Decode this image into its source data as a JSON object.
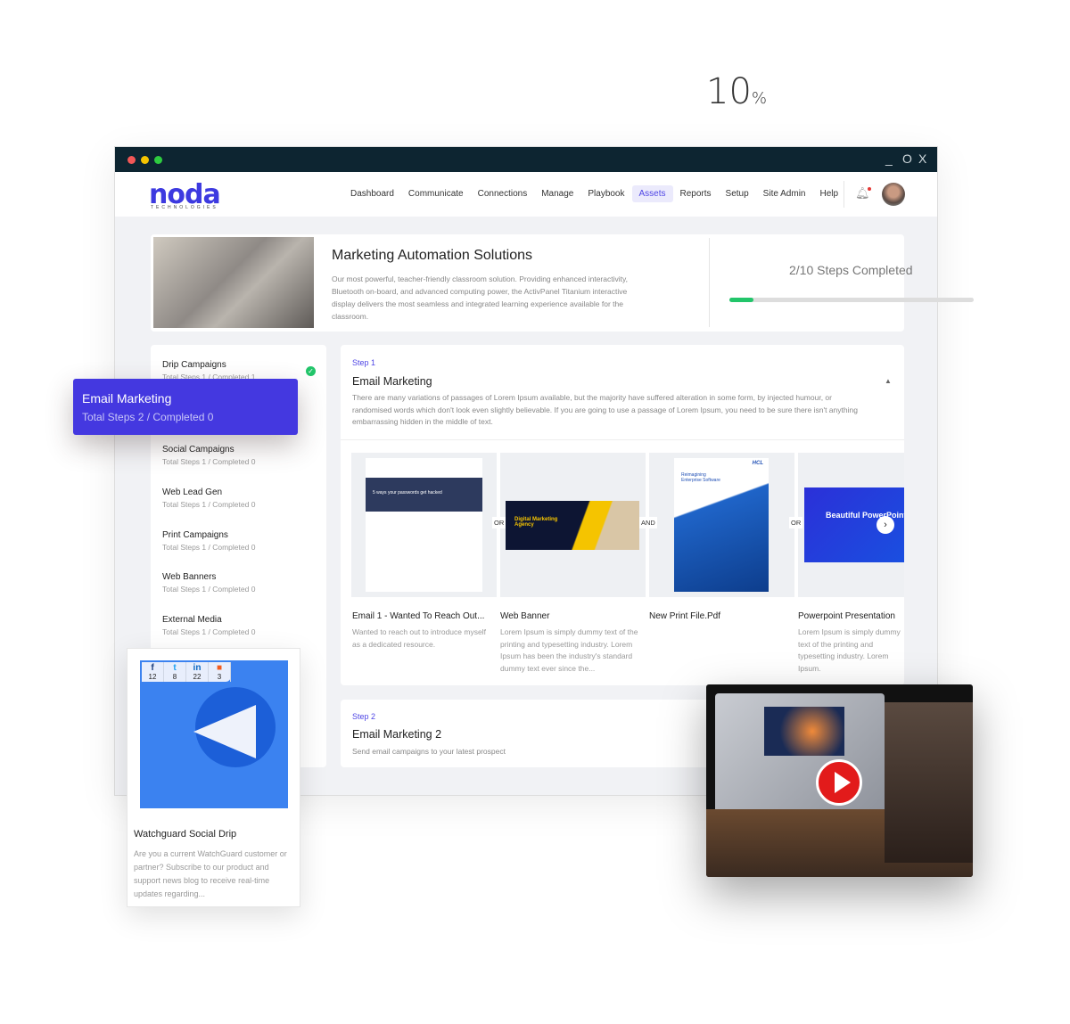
{
  "window": {
    "controls": [
      "_",
      "O",
      "X"
    ]
  },
  "header": {
    "logo": "noda",
    "logo_sub": "TECHNOLOGIES",
    "nav": [
      "Dashboard",
      "Communicate",
      "Connections",
      "Manage",
      "Playbook",
      "Assets",
      "Reports",
      "Setup",
      "Site Admin",
      "Help"
    ],
    "active": "Assets"
  },
  "hero": {
    "title": "Marketing Automation Solutions",
    "description": "Our most powerful, teacher-friendly classroom solution. Providing enhanced interactivity, Bluetooth on-board, and advanced computing power, the ActivPanel Titanium interactive display delivers the most seamless and integrated learning experience available for the classroom.",
    "percent": "10",
    "percent_sign": "%",
    "steps_completed": "2/10 Steps Completed",
    "progress": 10
  },
  "sidebar": {
    "items": [
      {
        "title": "Drip Campaigns",
        "sub": "Total Steps 1 / Completed 1"
      },
      {
        "title": "Email Marketing",
        "sub": "Total Steps 2 / Completed 0"
      },
      {
        "title": "Social Campaigns",
        "sub": "Total Steps 1 / Completed 0"
      },
      {
        "title": "Web Lead Gen",
        "sub": "Total Steps 1 / Completed 0"
      },
      {
        "title": "Print Campaigns",
        "sub": "Total Steps 1 / Completed 0"
      },
      {
        "title": "Web Banners",
        "sub": "Total Steps 1 / Completed 0"
      },
      {
        "title": "External Media",
        "sub": "Total Steps 1 / Completed 0"
      }
    ]
  },
  "step1": {
    "label": "Step 1",
    "title": "Email Marketing",
    "description": "There are many variations of passages of Lorem Ipsum available, but the majority have suffered alteration in some form, by injected humour, or randomised words which don't look even slightly believable. If you are going to use a passage of Lorem Ipsum, you need to be sure there isn't anything embarrassing hidden in the middle of text.",
    "assets": [
      {
        "name": "Email 1 - Wanted To Reach Out...",
        "description": "Wanted to reach out to introduce myself as a dedicated resource.",
        "thumb_text": "5 ways your passwords get hacked"
      },
      {
        "name": "Web Banner",
        "description": "Lorem Ipsum is simply dummy text of the printing and typesetting industry. Lorem Ipsum has been the industry's standard dummy text ever since the...",
        "thumb_text": "Digital Marketing Agency"
      },
      {
        "name": "New Print File.Pdf",
        "description": "",
        "thumb_text": "Reimagining Enterprise Software",
        "thumb_brand": "HCL"
      },
      {
        "name": "Powerpoint Presentation",
        "description": "Lorem Ipsum is simply dummy text of the printing and typesetting industry. Lorem Ipsum.",
        "thumb_text": "Beautiful PowerPoint Template"
      }
    ],
    "connectors": [
      "OR",
      "AND",
      "OR"
    ]
  },
  "step2": {
    "label": "Step 2",
    "title": "Email Marketing 2",
    "description": "Send email campaigns to your latest prospect"
  },
  "social": {
    "counts": [
      {
        "icon": "f",
        "n": "12"
      },
      {
        "icon": "t",
        "n": "8"
      },
      {
        "icon": "in",
        "n": "22"
      },
      {
        "icon": "b",
        "n": "3"
      }
    ],
    "title": "Watchguard Social Drip",
    "description": "Are you a current WatchGuard customer or partner? Subscribe to our product and support news blog to receive real-time updates regarding..."
  },
  "colors": {
    "accent": "#4438e0",
    "titlebar": "#0d2531",
    "success": "#22c56a"
  }
}
